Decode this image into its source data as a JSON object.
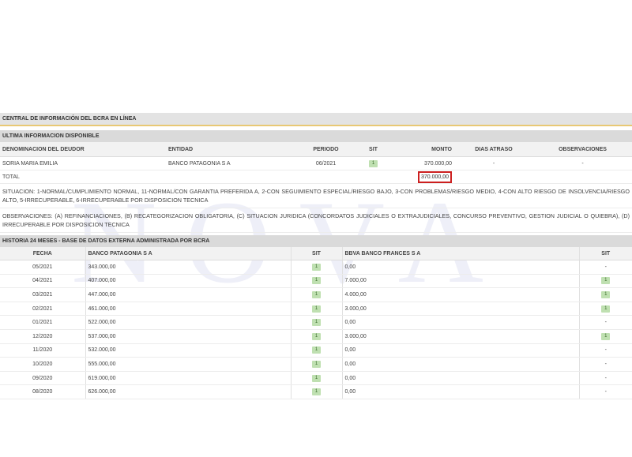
{
  "watermark": "NOVA",
  "title": "CENTRAL DE INFORMACIÓN DEL BCRA EN LÍNEA",
  "latest_section": {
    "label": "ULTIMA INFORMACION DISPONIBLE",
    "headers": [
      "DENOMINACION DEL DEUDOR",
      "ENTIDAD",
      "PERIODO",
      "SIT",
      "MONTO",
      "DIAS ATRASO",
      "OBSERVACIONES"
    ],
    "row": {
      "debtor": "SORIA MARIA EMILIA",
      "entity": "BANCO PATAGONIA S A",
      "period": "06/2021",
      "sit": "1",
      "amount": "370.000,00",
      "days_late": "-",
      "observations": "-"
    },
    "total_label": "TOTAL",
    "total_amount": "370.000,00"
  },
  "situacion_note": "SITUACION: 1-NORMAL/CUMPLIMIENTO NORMAL, 11-NORMAL/CON GARANTIA PREFERIDA A, 2-CON SEGUIMIENTO ESPECIAL/RIESGO BAJO, 3-CON PROBLEMAS/RIESGO MEDIO, 4-CON ALTO RIESGO DE INSOLVENCIA/RIESGO ALTO, 5-IRRECUPERABLE, 6-IRRECUPERABLE POR DISPOSICION TECNICA",
  "observaciones_note": "OBSERVACIONES: (A) REFINANCIACIONES, (B) RECATEGORIZACION OBLIGATORIA, (C) SITUACION JURIDICA (CONCORDATOS JUDICIALES O EXTRAJUDICIALES, CONCURSO PREVENTIVO, GESTION JUDICIAL O QUIEBRA), (D) IRRECUPERABLE POR DISPOSICION TECNICA",
  "history_section": {
    "label": "HISTORIA 24 MESES - BASE DE DATOS EXTERNA ADMINISTRADA POR BCRA",
    "headers": [
      "FECHA",
      "BANCO PATAGONIA S A",
      "SIT",
      "BBVA BANCO FRANCES S A",
      "SIT"
    ],
    "rows": [
      {
        "date": "05/2021",
        "amount1": "343.000,00",
        "sit1": "1",
        "amount2": "0,00",
        "sit2": "-"
      },
      {
        "date": "04/2021",
        "amount1": "407.000,00",
        "sit1": "1",
        "amount2": "7.000,00",
        "sit2": "1"
      },
      {
        "date": "03/2021",
        "amount1": "447.000,00",
        "sit1": "1",
        "amount2": "4.000,00",
        "sit2": "1"
      },
      {
        "date": "02/2021",
        "amount1": "461.000,00",
        "sit1": "1",
        "amount2": "3.000,00",
        "sit2": "1"
      },
      {
        "date": "01/2021",
        "amount1": "522.000,00",
        "sit1": "1",
        "amount2": "0,00",
        "sit2": "-"
      },
      {
        "date": "12/2020",
        "amount1": "537.000,00",
        "sit1": "1",
        "amount2": "3.000,00",
        "sit2": "1"
      },
      {
        "date": "11/2020",
        "amount1": "532.000,00",
        "sit1": "1",
        "amount2": "0,00",
        "sit2": "-"
      },
      {
        "date": "10/2020",
        "amount1": "555.000,00",
        "sit1": "1",
        "amount2": "0,00",
        "sit2": "-"
      },
      {
        "date": "09/2020",
        "amount1": "619.000,00",
        "sit1": "1",
        "amount2": "0,00",
        "sit2": "-"
      },
      {
        "date": "08/2020",
        "amount1": "626.000,00",
        "sit1": "1",
        "amount2": "0,00",
        "sit2": "-"
      }
    ]
  },
  "colors": {
    "title_underline": "#e8c874",
    "badge_bg": "#bfe0b1",
    "highlight_border": "#cc1f1f",
    "watermark": "#7882c8"
  }
}
